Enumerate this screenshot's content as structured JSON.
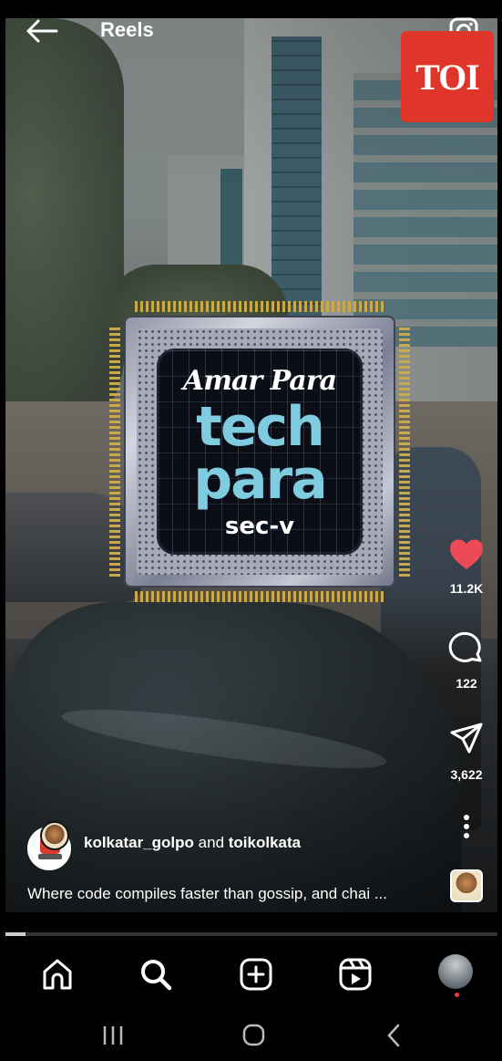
{
  "header": {
    "title": "Reels"
  },
  "overlay": {
    "publisher_logo_text": "TOI"
  },
  "graphic": {
    "line1": "Amar Para",
    "line2": "tech",
    "line3": "para",
    "line4": "sec-v"
  },
  "actions": {
    "like_count": "11.2K",
    "comment_count": "122",
    "share_count": "3,622"
  },
  "post": {
    "author_primary": "kolkatar_golpo",
    "connector": "and",
    "author_secondary": "toikolkata",
    "caption": "Where code compiles faster than gossip, and chai ..."
  },
  "playback": {
    "progress": 0.04
  },
  "colors": {
    "like": "#ed4956",
    "toi_red": "#e0352a",
    "notification_dot": "#ff3040"
  },
  "icons": {
    "back": "arrow-left",
    "camera": "camera",
    "like": "heart-filled",
    "comment": "chat-bubble",
    "share": "paper-plane",
    "more": "vertical-ellipsis",
    "home": "home",
    "search": "magnifier",
    "create": "plus-square",
    "reels": "reels-clapper"
  }
}
